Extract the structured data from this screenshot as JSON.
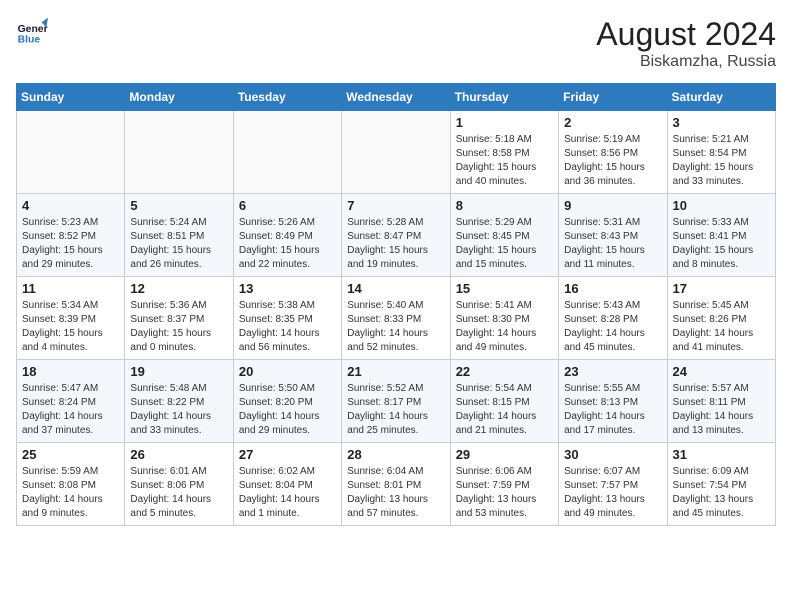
{
  "header": {
    "logo_line1": "General",
    "logo_line2": "Blue",
    "month_year": "August 2024",
    "location": "Biskamzha, Russia"
  },
  "weekdays": [
    "Sunday",
    "Monday",
    "Tuesday",
    "Wednesday",
    "Thursday",
    "Friday",
    "Saturday"
  ],
  "weeks": [
    [
      {
        "day": "",
        "info": ""
      },
      {
        "day": "",
        "info": ""
      },
      {
        "day": "",
        "info": ""
      },
      {
        "day": "",
        "info": ""
      },
      {
        "day": "1",
        "info": "Sunrise: 5:18 AM\nSunset: 8:58 PM\nDaylight: 15 hours\nand 40 minutes."
      },
      {
        "day": "2",
        "info": "Sunrise: 5:19 AM\nSunset: 8:56 PM\nDaylight: 15 hours\nand 36 minutes."
      },
      {
        "day": "3",
        "info": "Sunrise: 5:21 AM\nSunset: 8:54 PM\nDaylight: 15 hours\nand 33 minutes."
      }
    ],
    [
      {
        "day": "4",
        "info": "Sunrise: 5:23 AM\nSunset: 8:52 PM\nDaylight: 15 hours\nand 29 minutes."
      },
      {
        "day": "5",
        "info": "Sunrise: 5:24 AM\nSunset: 8:51 PM\nDaylight: 15 hours\nand 26 minutes."
      },
      {
        "day": "6",
        "info": "Sunrise: 5:26 AM\nSunset: 8:49 PM\nDaylight: 15 hours\nand 22 minutes."
      },
      {
        "day": "7",
        "info": "Sunrise: 5:28 AM\nSunset: 8:47 PM\nDaylight: 15 hours\nand 19 minutes."
      },
      {
        "day": "8",
        "info": "Sunrise: 5:29 AM\nSunset: 8:45 PM\nDaylight: 15 hours\nand 15 minutes."
      },
      {
        "day": "9",
        "info": "Sunrise: 5:31 AM\nSunset: 8:43 PM\nDaylight: 15 hours\nand 11 minutes."
      },
      {
        "day": "10",
        "info": "Sunrise: 5:33 AM\nSunset: 8:41 PM\nDaylight: 15 hours\nand 8 minutes."
      }
    ],
    [
      {
        "day": "11",
        "info": "Sunrise: 5:34 AM\nSunset: 8:39 PM\nDaylight: 15 hours\nand 4 minutes."
      },
      {
        "day": "12",
        "info": "Sunrise: 5:36 AM\nSunset: 8:37 PM\nDaylight: 15 hours\nand 0 minutes."
      },
      {
        "day": "13",
        "info": "Sunrise: 5:38 AM\nSunset: 8:35 PM\nDaylight: 14 hours\nand 56 minutes."
      },
      {
        "day": "14",
        "info": "Sunrise: 5:40 AM\nSunset: 8:33 PM\nDaylight: 14 hours\nand 52 minutes."
      },
      {
        "day": "15",
        "info": "Sunrise: 5:41 AM\nSunset: 8:30 PM\nDaylight: 14 hours\nand 49 minutes."
      },
      {
        "day": "16",
        "info": "Sunrise: 5:43 AM\nSunset: 8:28 PM\nDaylight: 14 hours\nand 45 minutes."
      },
      {
        "day": "17",
        "info": "Sunrise: 5:45 AM\nSunset: 8:26 PM\nDaylight: 14 hours\nand 41 minutes."
      }
    ],
    [
      {
        "day": "18",
        "info": "Sunrise: 5:47 AM\nSunset: 8:24 PM\nDaylight: 14 hours\nand 37 minutes."
      },
      {
        "day": "19",
        "info": "Sunrise: 5:48 AM\nSunset: 8:22 PM\nDaylight: 14 hours\nand 33 minutes."
      },
      {
        "day": "20",
        "info": "Sunrise: 5:50 AM\nSunset: 8:20 PM\nDaylight: 14 hours\nand 29 minutes."
      },
      {
        "day": "21",
        "info": "Sunrise: 5:52 AM\nSunset: 8:17 PM\nDaylight: 14 hours\nand 25 minutes."
      },
      {
        "day": "22",
        "info": "Sunrise: 5:54 AM\nSunset: 8:15 PM\nDaylight: 14 hours\nand 21 minutes."
      },
      {
        "day": "23",
        "info": "Sunrise: 5:55 AM\nSunset: 8:13 PM\nDaylight: 14 hours\nand 17 minutes."
      },
      {
        "day": "24",
        "info": "Sunrise: 5:57 AM\nSunset: 8:11 PM\nDaylight: 14 hours\nand 13 minutes."
      }
    ],
    [
      {
        "day": "25",
        "info": "Sunrise: 5:59 AM\nSunset: 8:08 PM\nDaylight: 14 hours\nand 9 minutes."
      },
      {
        "day": "26",
        "info": "Sunrise: 6:01 AM\nSunset: 8:06 PM\nDaylight: 14 hours\nand 5 minutes."
      },
      {
        "day": "27",
        "info": "Sunrise: 6:02 AM\nSunset: 8:04 PM\nDaylight: 14 hours\nand 1 minute."
      },
      {
        "day": "28",
        "info": "Sunrise: 6:04 AM\nSunset: 8:01 PM\nDaylight: 13 hours\nand 57 minutes."
      },
      {
        "day": "29",
        "info": "Sunrise: 6:06 AM\nSunset: 7:59 PM\nDaylight: 13 hours\nand 53 minutes."
      },
      {
        "day": "30",
        "info": "Sunrise: 6:07 AM\nSunset: 7:57 PM\nDaylight: 13 hours\nand 49 minutes."
      },
      {
        "day": "31",
        "info": "Sunrise: 6:09 AM\nSunset: 7:54 PM\nDaylight: 13 hours\nand 45 minutes."
      }
    ]
  ]
}
